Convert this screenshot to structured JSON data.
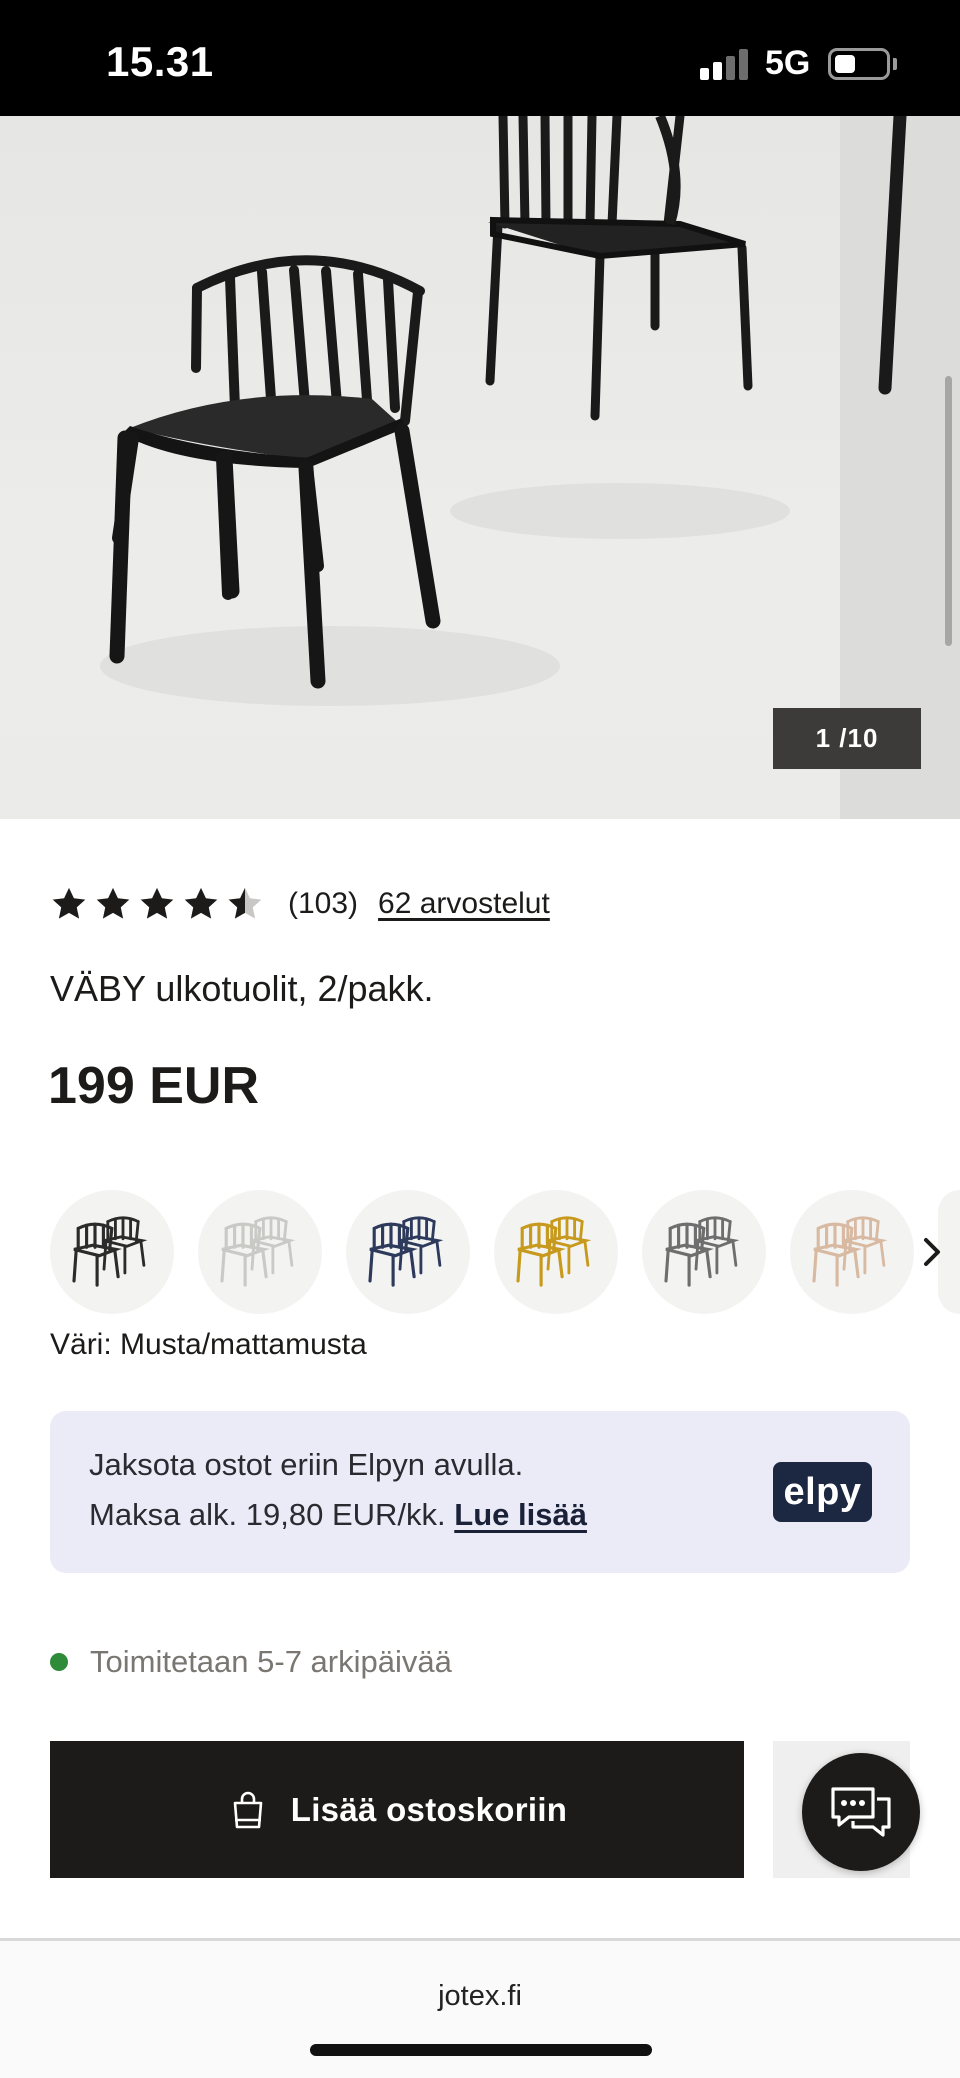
{
  "status_bar": {
    "time": "15.31",
    "network": "5G"
  },
  "gallery": {
    "counter": "1 /10"
  },
  "product": {
    "rating_value": 4.5,
    "rating_count": "(103)",
    "reviews_link": "62 arvostelut",
    "title": "VÄBY ulkotuolit, 2/pakk.",
    "price": "199 EUR",
    "swatch_colors": [
      "#2b2b2b",
      "#e9e9e7",
      "#2d3a5c",
      "#c79a1d",
      "#6e6e6e",
      "#d8b9a2"
    ],
    "color_label": "Väri: Musta/mattamusta"
  },
  "elpy": {
    "line1": "Jaksota ostot eriin Elpyn avulla.",
    "line2_prefix": "Maksa alk. 19,80 EUR/kk.",
    "link": "Lue lisää",
    "logo": "elpy"
  },
  "delivery": {
    "text": "Toimitetaan 5-7 arkipäivää",
    "status_color": "#2e8b3a"
  },
  "cart": {
    "button_label": "Lisää ostoskoriin"
  },
  "browser": {
    "url": "jotex.fi"
  },
  "icons": {
    "cart": "shopping-bag-icon",
    "chat": "chat-icon",
    "next": "chevron-right-icon",
    "star": "star-icon"
  }
}
